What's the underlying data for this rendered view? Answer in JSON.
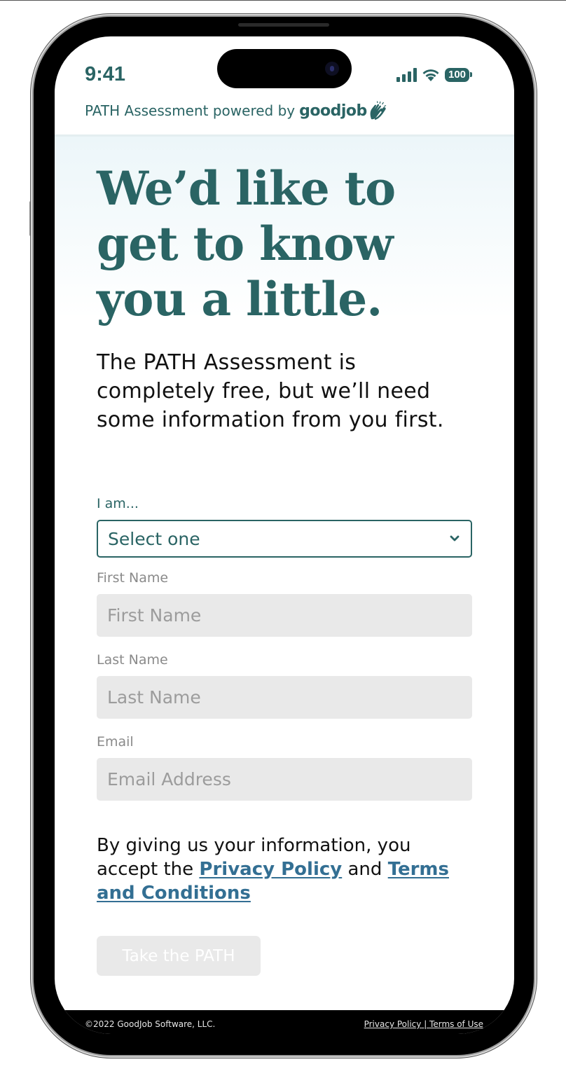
{
  "status_bar": {
    "time": "9:41",
    "signal_icon": "cellular-signal-icon",
    "wifi_icon": "wifi-icon",
    "battery_level": "100"
  },
  "brand": {
    "prefix": "PATH Assessment powered by",
    "logo_text": "goodjob",
    "logo_icon": "clapping-hands-icon"
  },
  "headline": "We’d like to get to know you a little.",
  "intro": "The PATH Assessment is completely free, but we’ll need some information from you first.",
  "form": {
    "role": {
      "label": "I am...",
      "selected": "Select one",
      "icon": "chevron-down-icon"
    },
    "first_name": {
      "label": "First Name",
      "placeholder": "First Name",
      "value": ""
    },
    "last_name": {
      "label": "Last Name",
      "placeholder": "Last Name",
      "value": ""
    },
    "email": {
      "label": "Email",
      "placeholder": "Email Address",
      "value": ""
    }
  },
  "consent": {
    "text_before": "By giving us your information, you accept the ",
    "privacy_link": "Privacy Policy",
    "and": " and ",
    "terms_link": "Terms and Conditions"
  },
  "cta": {
    "label": "Take the PATH",
    "enabled": false
  },
  "footer": {
    "copyright": "©2022 GoodJob Software, LLC.",
    "privacy_link": "Privacy Policy",
    "separator": " | ",
    "terms_link": "Terms of Use"
  },
  "colors": {
    "brand": "#2a6464",
    "link": "#336f93",
    "input_bg": "#e9e9e9",
    "footer_bg": "#000000"
  }
}
